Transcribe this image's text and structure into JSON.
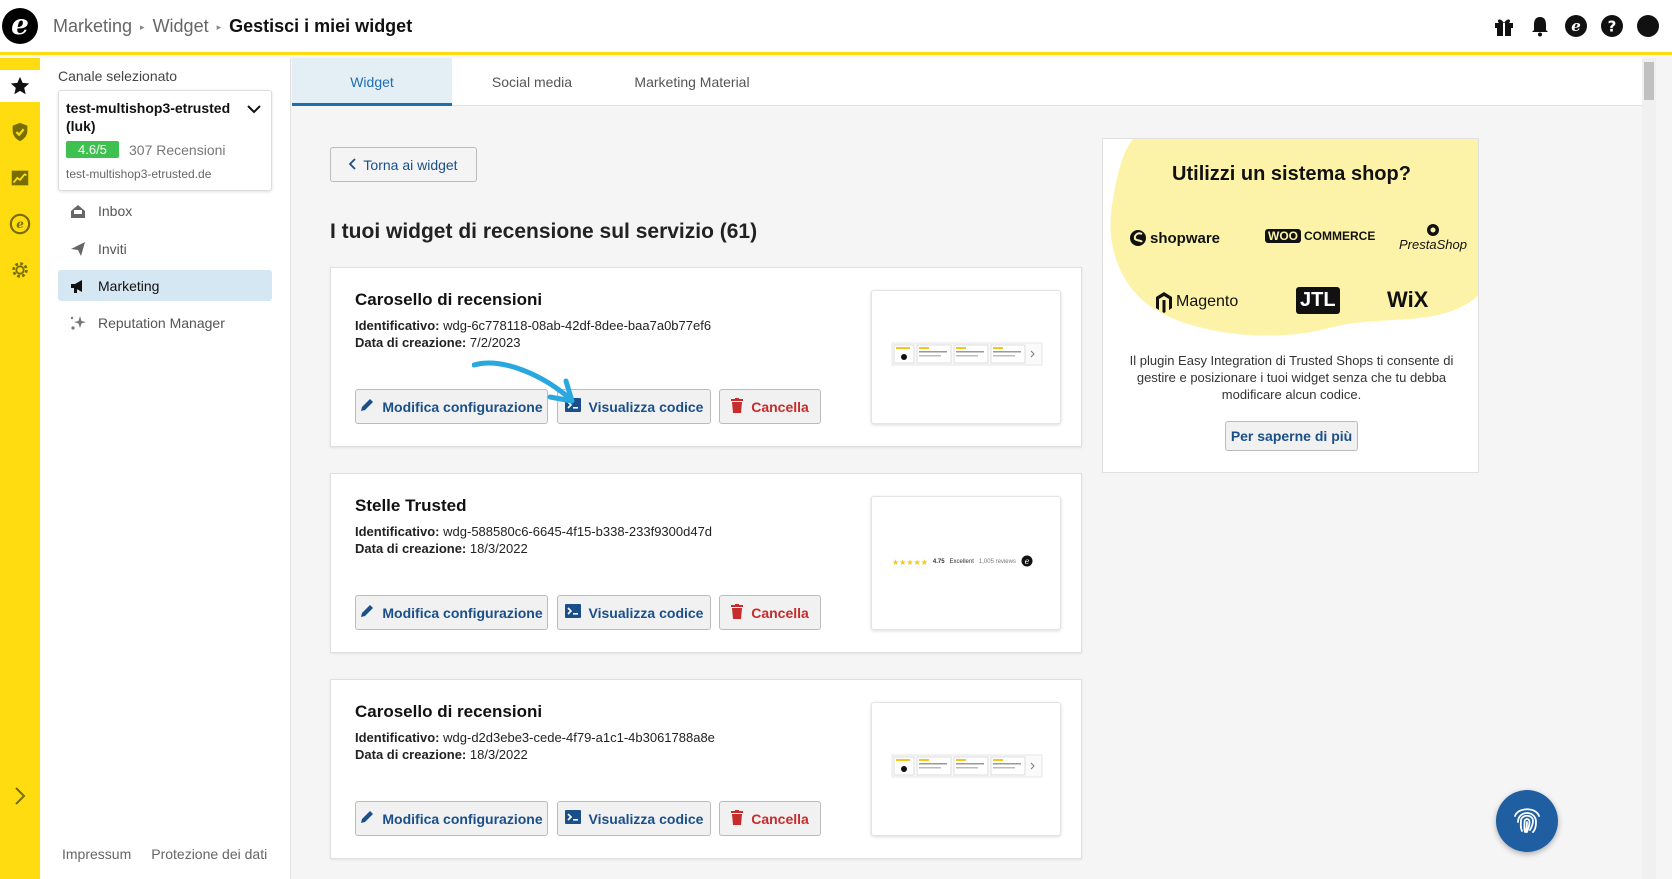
{
  "breadcrumb": {
    "items": [
      "Marketing",
      "Widget"
    ],
    "current": "Gestisci i miei widget"
  },
  "topbar": {
    "icons": [
      "gift-icon",
      "bell-icon",
      "etrusted-icon",
      "help-icon",
      "profile-icon"
    ]
  },
  "rail": {
    "icons": [
      "star-icon",
      "shield-check-icon",
      "chart-icon",
      "etrusted-icon",
      "gear-icon",
      "chevron-right-icon"
    ]
  },
  "sidebar": {
    "channel_label": "Canale selezionato",
    "channel": {
      "name": "test-multishop3-etrusted (luk)",
      "rating": "4.6/5",
      "reviews": "307 Recensioni",
      "url": "test-multishop3-etrusted.de"
    },
    "nav": [
      {
        "label": "Inbox",
        "icon": "inbox-icon"
      },
      {
        "label": "Inviti",
        "icon": "send-icon"
      },
      {
        "label": "Marketing",
        "icon": "megaphone-icon",
        "active": true
      },
      {
        "label": "Reputation Manager",
        "icon": "sparkle-icon"
      }
    ],
    "footer": [
      "Impressum",
      "Protezione dei dati"
    ]
  },
  "tabs": [
    {
      "label": "Widget",
      "active": true
    },
    {
      "label": "Social media"
    },
    {
      "label": "Marketing Material"
    }
  ],
  "main": {
    "back_label": "Torna ai widget",
    "section_title": "I tuoi widget di recensione sul servizio (61)",
    "id_label": "Identificativo:",
    "date_label": "Data di creazione:",
    "buttons": {
      "edit": "Modifica configurazione",
      "code": "Visualizza codice",
      "delete": "Cancella"
    },
    "widgets": [
      {
        "title": "Carosello di recensioni",
        "id": "wdg-6c778118-08ab-42df-8dee-baa7a0b77ef6",
        "date": "7/2/2023"
      },
      {
        "title": "Stelle Trusted",
        "id": "wdg-588580c6-6645-4f15-b338-233f9300d47d",
        "date": "18/3/2022",
        "preview": {
          "rating": "4.75",
          "grade": "Excellent",
          "count": "1,005 reviews"
        }
      },
      {
        "title": "Carosello di recensioni",
        "id": "wdg-d2d3ebe3-cede-4f79-a1c1-4b3061788a8e",
        "date": "18/3/2022"
      }
    ]
  },
  "promo": {
    "title": "Utilizzi un sistema shop?",
    "logos": [
      "shopware",
      "COMMERCE",
      "PrestaShop",
      "Magento",
      "JTL",
      "WiX"
    ],
    "logo_woo": "WOO",
    "text": "Il plugin Easy Integration di Trusted Shops ti consente di gestire e posizionare i tuoi widget senza che tu debba modificare alcun codice.",
    "button": "Per saperne di più"
  },
  "colors": {
    "accent_yellow": "#ffdc0f",
    "primary_blue": "#1f6fb0",
    "rating_green": "#3ec14f",
    "delete_red": "#c72c2c",
    "fab_blue": "#1e5ea1"
  }
}
